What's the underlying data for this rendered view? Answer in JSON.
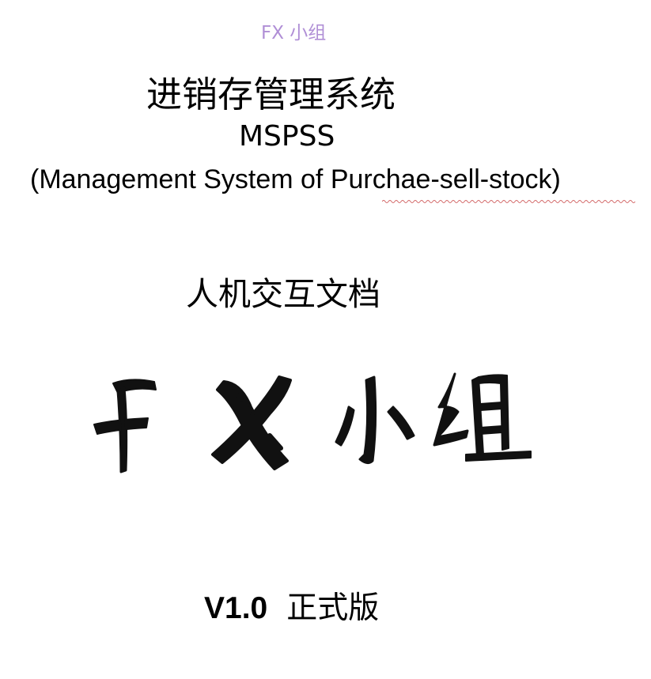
{
  "header": {
    "group_name": "FX 小组"
  },
  "title": {
    "chinese": "进销存管理系统",
    "abbreviation": "MSPSS",
    "english": "(Management System of Purchae-sell-stock)"
  },
  "document": {
    "type": "人机交互文档"
  },
  "logo": {
    "text": "FX小组"
  },
  "version": {
    "number": "V1.0",
    "label": "正式版"
  },
  "colors": {
    "header_text": "#b08fd6",
    "spellcheck_underline": "#d06060",
    "ink": "#000000"
  }
}
